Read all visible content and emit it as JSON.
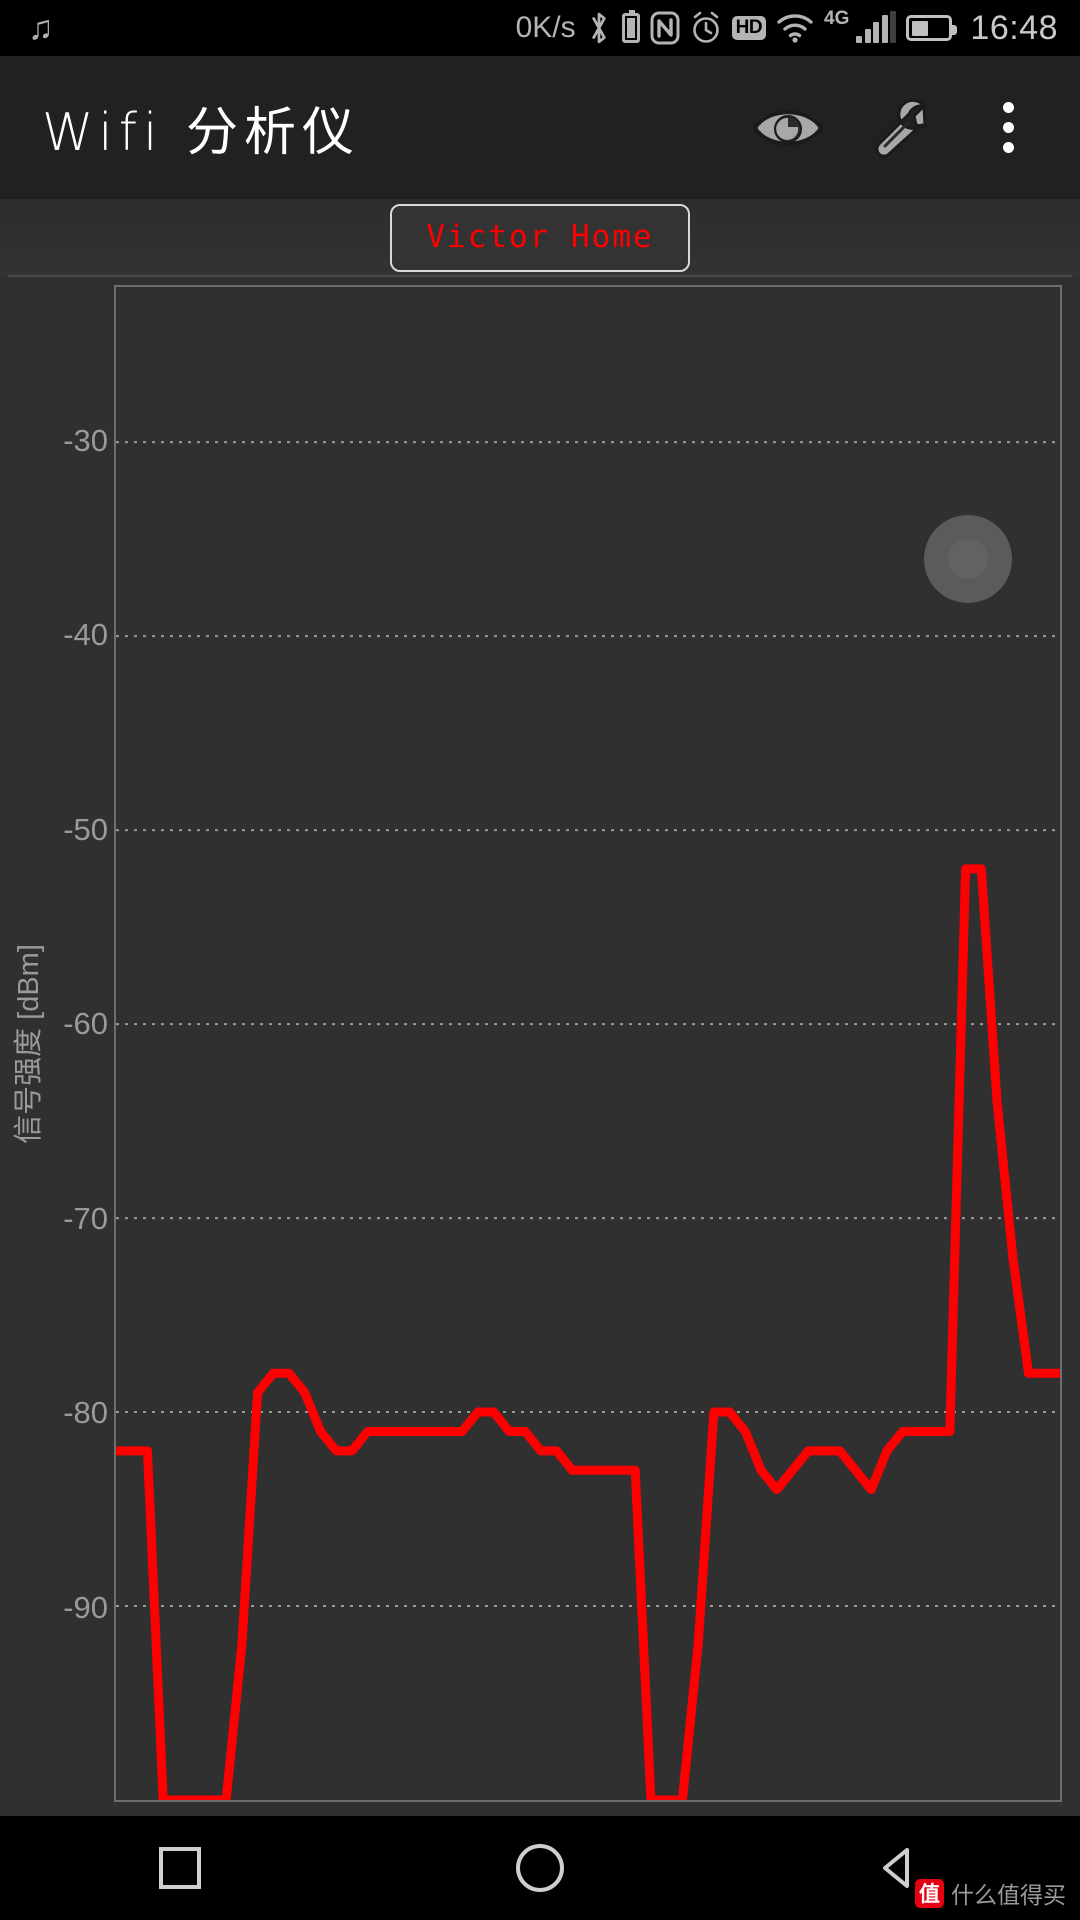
{
  "statusbar": {
    "music_icon": "music-note-icon",
    "net_speed": "0K/s",
    "bluetooth_icon": "bluetooth-icon",
    "bt_battery_icon": "bluetooth-battery-icon",
    "nfc_icon": "nfc-icon",
    "alarm_icon": "alarm-clock-icon",
    "hd_label": "HD",
    "wifi_icon": "wifi-icon",
    "mobile_network": "4G",
    "signal_icon": "signal-bars-icon",
    "battery_icon": "battery-icon",
    "battery_percent": 45,
    "time": "16:48"
  },
  "appbar": {
    "title": "Wifi 分析仪",
    "actions": [
      {
        "name": "eye-icon",
        "label": "显示"
      },
      {
        "name": "wrench-icon",
        "label": "设置"
      },
      {
        "name": "overflow-menu-icon",
        "label": "更多"
      }
    ]
  },
  "tabs": [
    {
      "label": "Victor Home",
      "selected": true,
      "color": "#ff0000"
    }
  ],
  "colors": {
    "accent": "#ff0000",
    "appbar_bg": "#212121",
    "page_bg": "#303030",
    "grid": "#9a9a9a",
    "axis": "#6e6e6e"
  },
  "fab": {
    "name": "scroll-lock-fab",
    "label": ""
  },
  "navbar": {
    "recents": "recents-button",
    "home": "home-button",
    "back": "back-button"
  },
  "watermark": {
    "badge": "值",
    "text": "什么值得买"
  },
  "chart_data": {
    "type": "line",
    "title": "Victor Home",
    "xlabel": "",
    "ylabel": "信号强度 [dBm]",
    "ylim": [
      -100,
      -22
    ],
    "ytick_labels": [
      "-30",
      "-40",
      "-50",
      "-60",
      "-70",
      "-80",
      "-90"
    ],
    "yticks": [
      -30,
      -40,
      -50,
      -60,
      -70,
      -80,
      -90
    ],
    "grid": true,
    "grid_style": "dotted",
    "legend": "none",
    "xlim": [
      0,
      60
    ],
    "series": [
      {
        "name": "Victor Home",
        "color": "#ff0000",
        "x": [
          0,
          1,
          2,
          3,
          4,
          5,
          6,
          7,
          8,
          9,
          10,
          11,
          12,
          13,
          14,
          15,
          16,
          17,
          18,
          19,
          20,
          21,
          22,
          23,
          24,
          25,
          26,
          27,
          28,
          29,
          30,
          31,
          32,
          33,
          34,
          35,
          36,
          37,
          38,
          39,
          40,
          41,
          42,
          43,
          44,
          45,
          46,
          47,
          48,
          49,
          50,
          51,
          52,
          53,
          54,
          55,
          56,
          57,
          58,
          59,
          60
        ],
        "values": [
          -82,
          -82,
          -82,
          -100,
          -100,
          -100,
          -100,
          -100,
          -92,
          -79,
          -78,
          -78,
          -79,
          -81,
          -82,
          -82,
          -81,
          -81,
          -81,
          -81,
          -81,
          -81,
          -81,
          -80,
          -80,
          -81,
          -81,
          -82,
          -82,
          -83,
          -83,
          -83,
          -83,
          -83,
          -100,
          -100,
          -100,
          -92,
          -80,
          -80,
          -81,
          -83,
          -84,
          -83,
          -82,
          -82,
          -82,
          -83,
          -84,
          -82,
          -81,
          -81,
          -81,
          -81,
          -52,
          -52,
          -64,
          -72,
          -78,
          -78,
          -78
        ]
      }
    ]
  }
}
